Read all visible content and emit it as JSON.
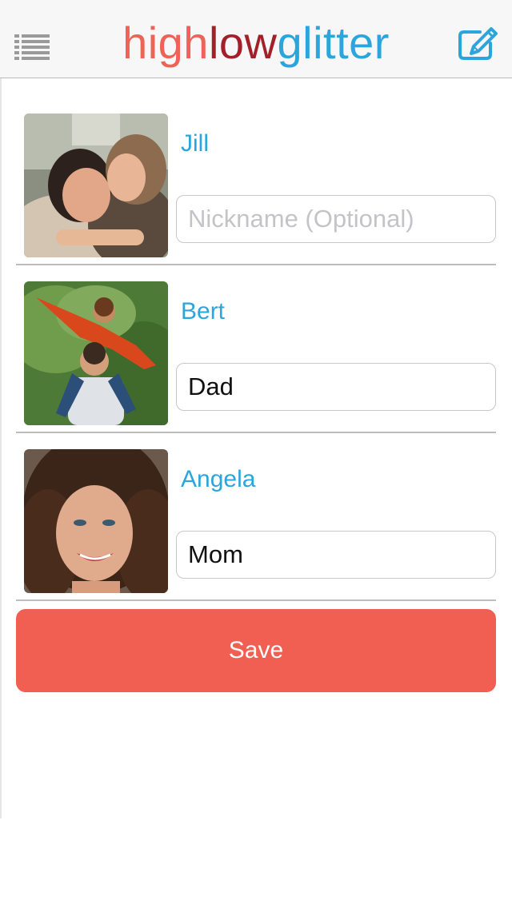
{
  "header": {
    "logo_parts": [
      "high",
      "low",
      "glitter"
    ],
    "menu_icon": "list-menu-icon",
    "compose_icon": "compose-edit-icon"
  },
  "contacts": [
    {
      "name": "Jill",
      "nickname_value": "",
      "nickname_placeholder": "Nickname (Optional)",
      "photo_icon": "jill-photo"
    },
    {
      "name": "Bert",
      "nickname_value": "Dad",
      "nickname_placeholder": "Nickname (Optional)",
      "photo_icon": "bert-photo"
    },
    {
      "name": "Angela",
      "nickname_value": "Mom",
      "nickname_placeholder": "Nickname (Optional)",
      "photo_icon": "angela-photo"
    }
  ],
  "save_label": "Save",
  "colors": {
    "accent_blue": "#2aa6dc",
    "logo_high": "#ee6258",
    "logo_low": "#a3202b",
    "save_button": "#f05f52",
    "header_bg": "#f7f7f7"
  }
}
